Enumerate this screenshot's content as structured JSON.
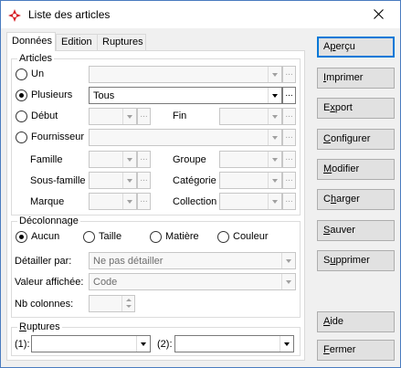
{
  "window": {
    "title": "Liste des articles",
    "icon": "app-red-icon",
    "close_icon": "close-icon"
  },
  "tabs": [
    {
      "label": "Données",
      "active": true
    },
    {
      "label": "Edition",
      "active": false
    },
    {
      "label": "Ruptures",
      "active": false
    }
  ],
  "articles": {
    "title": "Articles",
    "un": {
      "label": "Un",
      "value": ""
    },
    "plusieurs": {
      "label": "Plusieurs",
      "value": "Tous",
      "checked": true
    },
    "debut": {
      "label": "Début",
      "value": ""
    },
    "fin": {
      "label": "Fin",
      "value": ""
    },
    "fournisseur": {
      "label": "Fournisseur",
      "value": ""
    },
    "famille": {
      "label": "Famille",
      "value": ""
    },
    "groupe": {
      "label": "Groupe",
      "value": ""
    },
    "sous_famille": {
      "label": "Sous-famille",
      "value": ""
    },
    "categorie": {
      "label": "Catégorie",
      "value": ""
    },
    "marque": {
      "label": "Marque",
      "value": ""
    },
    "collection": {
      "label": "Collection",
      "value": ""
    },
    "dots": "..."
  },
  "decolonnage": {
    "title": "Décolonnage",
    "options": [
      {
        "label": "Aucun",
        "checked": true
      },
      {
        "label": "Taille",
        "checked": false
      },
      {
        "label": "Matière",
        "checked": false
      },
      {
        "label": "Couleur",
        "checked": false
      }
    ],
    "detailler_label": "Détailler par:",
    "detailler_value": "Ne pas détailler",
    "valeur_label": "Valeur affichée:",
    "valeur_value": "Code",
    "nb_colonnes_label": "Nb colonnes:",
    "nb_colonnes_value": ""
  },
  "ruptures": {
    "title": "Ruptures",
    "r1_label": "(1):",
    "r1_value": "",
    "r2_label": "(2):",
    "r2_value": ""
  },
  "buttons": {
    "apercu": {
      "first": "A",
      "u": "p",
      "rest": "erçu"
    },
    "imprimer": {
      "u": "I",
      "rest": "mprimer"
    },
    "export": {
      "first": "E",
      "u": "x",
      "rest": "port"
    },
    "configurer": {
      "u": "C",
      "rest": "onfigurer"
    },
    "modifier": {
      "u": "M",
      "rest": "odifier"
    },
    "charger": {
      "first": "C",
      "u": "h",
      "rest": "arger"
    },
    "sauver": {
      "u": "S",
      "rest": "auver"
    },
    "supprimer": {
      "first": "S",
      "u": "u",
      "rest": "pprimer"
    },
    "aide": {
      "u": "A",
      "rest": "ide"
    },
    "fermer": {
      "u": "F",
      "rest": "ermer"
    }
  },
  "colors": {
    "accent": "#0078d7",
    "title_border": "#4a7bbf",
    "icon_red": "#d8232a"
  }
}
